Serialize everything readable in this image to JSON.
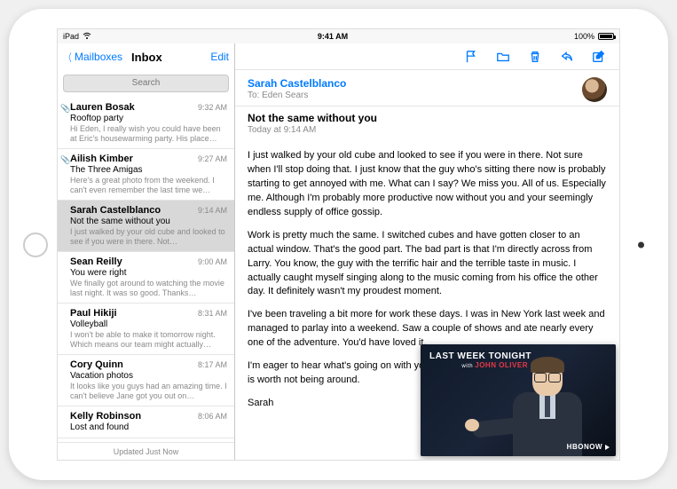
{
  "statusbar": {
    "device": "iPad",
    "time": "9:41 AM",
    "battery": "100%"
  },
  "sidebar": {
    "back": "Mailboxes",
    "title": "Inbox",
    "edit": "Edit",
    "search_placeholder": "Search",
    "footer": "Updated Just Now",
    "items": [
      {
        "sender": "Lauren Bosak",
        "time": "9:32 AM",
        "subject": "Rooftop party",
        "preview": "Hi Eden, I really wish you could have been at Eric's housewarming party. His place…",
        "attachment": true
      },
      {
        "sender": "Ailish Kimber",
        "time": "9:27 AM",
        "subject": "The Three Amigas",
        "preview": "Here's a great photo from the weekend. I can't even remember the last time we…",
        "attachment": true
      },
      {
        "sender": "Sarah Castelblanco",
        "time": "9:14 AM",
        "subject": "Not the same without you",
        "preview": "I just walked by your old cube and looked to see if you were in there. Not…",
        "attachment": false,
        "selected": true
      },
      {
        "sender": "Sean Reilly",
        "time": "9:00 AM",
        "subject": "You were right",
        "preview": "We finally got around to watching the movie last night. It was so good. Thanks…",
        "attachment": false
      },
      {
        "sender": "Paul Hikiji",
        "time": "8:31 AM",
        "subject": "Volleyball",
        "preview": "I won't be able to make it tomorrow night. Which means our team might actually…",
        "attachment": false
      },
      {
        "sender": "Cory Quinn",
        "time": "8:17 AM",
        "subject": "Vacation photos",
        "preview": "It looks like you guys had an amazing time. I can't believe Jane got you out on…",
        "attachment": false
      },
      {
        "sender": "Kelly Robinson",
        "time": "8:06 AM",
        "subject": "Lost and found",
        "preview": "",
        "attachment": false
      }
    ]
  },
  "message": {
    "from": "Sarah Castelblanco",
    "to": "To: Eden Sears",
    "subject": "Not the same without you",
    "date": "Today at 9:14 AM",
    "p1": "I just walked by your old cube and looked to see if you were in there. Not sure when I'll stop doing that. I just know that the guy who's sitting there now is probably starting to get annoyed with me. What can I say? We miss you. All of us. Especially me. Although I'm probably more productive now without you and your seemingly endless supply of office gossip.",
    "p2": "Work is pretty much the same. I switched cubes and have gotten closer to an actual window. That's the good part. The bad part is that I'm directly across from Larry. You know, the guy with the terrific hair and the terrible taste in music. I actually caught myself singing along to the music coming from his office the other day. It definitely wasn't my proudest moment.",
    "p3": "I've been traveling a bit more for work these days. I was in New York last week and managed to parlay into a weekend. Saw a couple of shows and ate nearly every one of the adventure. You'd have loved it.",
    "p4": "I'm eager to hear what's going on with you and whether your career advancement is worth not being around.",
    "signoff": "Sarah"
  },
  "pip": {
    "title_line1": "LAST WEEK TONIGHT",
    "with": "with",
    "host": "JOHN OLIVER",
    "network": "HBONOW"
  }
}
